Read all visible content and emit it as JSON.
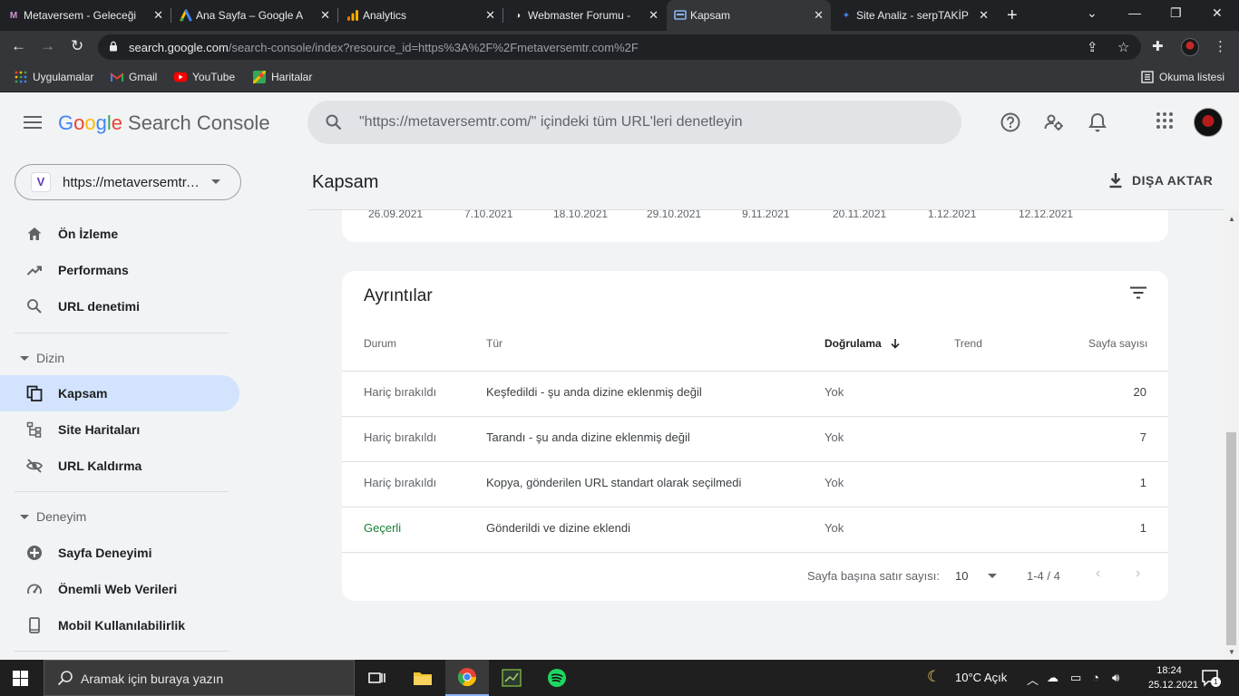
{
  "browser": {
    "tabs": [
      {
        "label": "Metaversem - Geleceği",
        "active": false,
        "favicon": "metaversem-favicon",
        "favicon_color": "#8e24aa"
      },
      {
        "label": "Ana Sayfa – Google A",
        "active": false,
        "favicon": "google-ads-favicon",
        "favicon_color": "#fbbc04"
      },
      {
        "label": "Analytics",
        "active": false,
        "favicon": "analytics-favicon",
        "favicon_color": "#f9ab00"
      },
      {
        "label": "Webmaster Forumu -",
        "active": false,
        "favicon": "webmaster-forum-favicon",
        "favicon_color": "#e8eaed"
      },
      {
        "label": "Kapsam",
        "active": true,
        "favicon": "search-console-favicon",
        "favicon_color": "#8ab4f8"
      },
      {
        "label": "Site Analiz - serpTAKİP",
        "active": false,
        "favicon": "serptakip-favicon",
        "favicon_color": "#4285f4"
      }
    ],
    "url_host": "search.google.com",
    "url_path": "/search-console/index?resource_id=https%3A%2F%2Fmetaversemtr.com%2F",
    "bookmarks": [
      {
        "label": "Uygulamalar",
        "icon": "apps-grid-icon"
      },
      {
        "label": "Gmail",
        "icon": "gmail-icon"
      },
      {
        "label": "YouTube",
        "icon": "youtube-icon"
      },
      {
        "label": "Haritalar",
        "icon": "maps-icon"
      }
    ],
    "reading_list": "Okuma listesi"
  },
  "app": {
    "logo_google": "Google",
    "logo_product": "Search Console",
    "search_placeholder": "\"https://metaversemtr.com/\" içindeki tüm URL'leri denetleyin",
    "property": "https://metaversemtr.com/",
    "property_initial": "V"
  },
  "sidebar": {
    "items": [
      {
        "label": "Ön İzleme",
        "icon": "home-icon"
      },
      {
        "label": "Performans",
        "icon": "trending-up-icon"
      },
      {
        "label": "URL denetimi",
        "icon": "search-icon"
      }
    ],
    "section_index": "Dizin",
    "index_items": [
      {
        "label": "Kapsam",
        "icon": "file-copy-icon",
        "active": true
      },
      {
        "label": "Site Haritaları",
        "icon": "sitemap-icon"
      },
      {
        "label": "URL Kaldırma",
        "icon": "visibility-off-icon"
      }
    ],
    "section_experience": "Deneyim",
    "experience_items": [
      {
        "label": "Sayfa Deneyimi",
        "icon": "page-experience-icon"
      },
      {
        "label": "Önemli Web Verileri",
        "icon": "speed-icon"
      },
      {
        "label": "Mobil Kullanılabilirlik",
        "icon": "smartphone-icon"
      }
    ]
  },
  "page": {
    "title": "Kapsam",
    "export_label": "DIŞA AKTAR"
  },
  "chart": {
    "x_ticks": [
      "26.09.2021",
      "7.10.2021",
      "18.10.2021",
      "29.10.2021",
      "9.11.2021",
      "20.11.2021",
      "1.12.2021",
      "12.12.2021"
    ]
  },
  "details": {
    "title": "Ayrıntılar",
    "columns": {
      "status": "Durum",
      "type": "Tür",
      "validation": "Doğrulama",
      "trend": "Trend",
      "pages": "Sayfa sayısı"
    },
    "rows": [
      {
        "status": "Hariç bırakıldı",
        "type": "Keşfedildi - şu anda dizine eklenmiş değil",
        "validation": "Yok",
        "pages": "20"
      },
      {
        "status": "Hariç bırakıldı",
        "type": "Tarandı - şu anda dizine eklenmiş değil",
        "validation": "Yok",
        "pages": "7"
      },
      {
        "status": "Hariç bırakıldı",
        "type": "Kopya, gönderilen URL standart olarak seçilmedi",
        "validation": "Yok",
        "pages": "1"
      },
      {
        "status": "Geçerli",
        "type": "Gönderildi ve dizine eklendi",
        "validation": "Yok",
        "pages": "1"
      }
    ],
    "rows_per_page_label": "Sayfa başına satır sayısı:",
    "rows_per_page": "10",
    "range": "1-4 / 4"
  },
  "taskbar": {
    "search_placeholder": "Aramak için buraya yazın",
    "weather": "10°C  Açık",
    "time": "18:24",
    "date": "25.12.2021",
    "notifications": "1"
  },
  "colors": {
    "accent": "#1a73e8",
    "active_nav_bg": "#d3e3fd",
    "valid_status": "#188038"
  }
}
